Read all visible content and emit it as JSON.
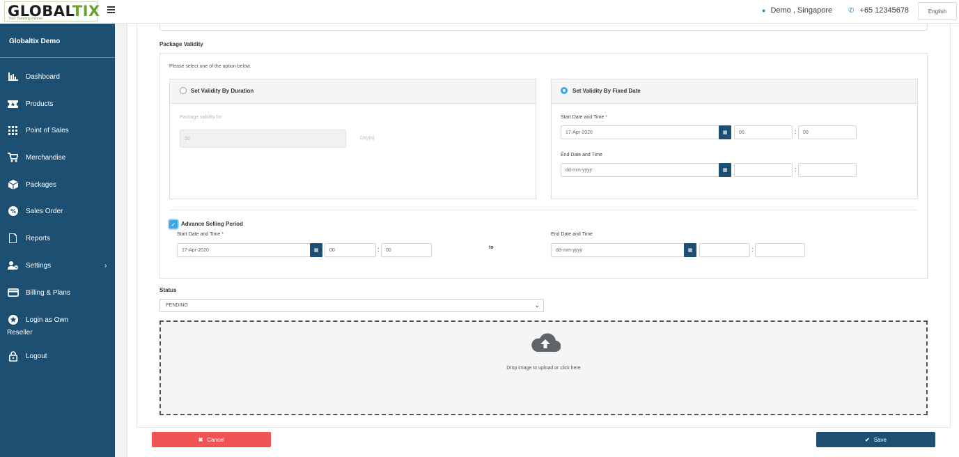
{
  "header": {
    "logo": {
      "brand_main": "GLOBAL",
      "brand_accent": "TIX",
      "tagline": "Your Ticketing Partner"
    },
    "user": "Demo , Singapore",
    "phone": "+65 12345678",
    "language": "English"
  },
  "sidebar": {
    "title": "Globaltix Demo",
    "items": [
      {
        "label": "Dashboard",
        "icon": "bar-chart-icon"
      },
      {
        "label": "Products",
        "icon": "ticket-icon"
      },
      {
        "label": "Point of Sales",
        "icon": "grid-icon"
      },
      {
        "label": "Merchandise",
        "icon": "cart-icon"
      },
      {
        "label": "Packages",
        "icon": "cube-icon"
      },
      {
        "label": "Sales Order",
        "icon": "badge-percent-icon"
      },
      {
        "label": "Reports",
        "icon": "file-icon"
      },
      {
        "label": "Settings",
        "icon": "user-gear-icon"
      },
      {
        "label": "Billing & Plans",
        "icon": "credit-card-icon"
      },
      {
        "label": "Login as Own",
        "label2": "Reseller",
        "icon": "star-circle-icon"
      },
      {
        "label": "Logout",
        "icon": "lock-icon"
      }
    ]
  },
  "package_validity": {
    "section_label": "Package Validity",
    "hint": "Please select one of the option below.",
    "duration": {
      "label": "Set Validity By Duration",
      "selected": false,
      "field_label": "Package validity for",
      "value": "30",
      "unit": "Day(s)"
    },
    "fixed_date": {
      "label": "Set Validity By Fixed Date",
      "selected": true,
      "start_label": "Start Date and Time",
      "required_mark": "*",
      "start_date": "17-Apr-2020",
      "start_hour": "00",
      "start_min": "00",
      "end_label": "End Date and Time",
      "end_date_placeholder": "dd-mm-yyyy",
      "end_hour": "",
      "end_min": ""
    }
  },
  "advance_selling": {
    "label": "Advance Selling Period",
    "checked": true,
    "start_label": "Start Date and Time",
    "required_mark": "*",
    "start_date": "17-Apr-2020",
    "start_hour": "00",
    "start_min": "00",
    "to_label": "to",
    "end_label": "End Date and Time",
    "end_date_placeholder": "dd-mm-yyyy",
    "end_hour": "",
    "end_min": ""
  },
  "status": {
    "label": "Status",
    "value": "PENDING"
  },
  "upload": {
    "text": "Drop image to upload or click here"
  },
  "actions": {
    "cancel": "Cancel",
    "save": "Save"
  },
  "colors": {
    "sidebar": "#1d4f73",
    "accent": "#3ba7e6",
    "cancel": "#ee5454",
    "primary": "#1d4f73"
  }
}
